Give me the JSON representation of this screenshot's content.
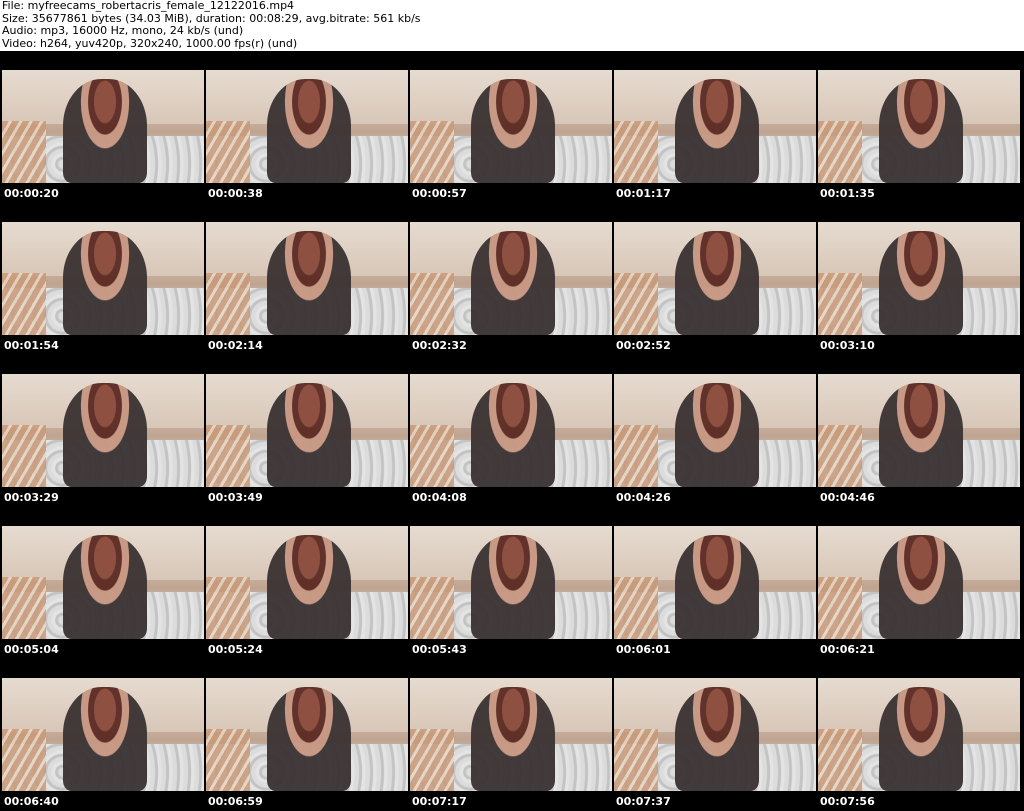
{
  "header": {
    "file": "File: myfreecams_robertacris_female_12122016.mp4",
    "size": "Size: 35677861 bytes (34.03 MiB), duration: 00:08:29, avg.bitrate: 561 kb/s",
    "audio": "Audio: mp3, 16000 Hz, mono, 24 kb/s (und)",
    "video": "Video: h264, yuv420p, 320x240, 1000.00 fps(r) (und)"
  },
  "rows": [
    [
      "00:00:20",
      "00:00:38",
      "00:00:57",
      "00:01:17",
      "00:01:35"
    ],
    [
      "00:01:54",
      "00:02:14",
      "00:02:32",
      "00:02:52",
      "00:03:10"
    ],
    [
      "00:03:29",
      "00:03:49",
      "00:04:08",
      "00:04:26",
      "00:04:46"
    ],
    [
      "00:05:04",
      "00:05:24",
      "00:05:43",
      "00:06:01",
      "00:06:21"
    ],
    [
      "00:06:40",
      "00:06:59",
      "00:07:17",
      "00:07:37",
      "00:07:56"
    ]
  ]
}
